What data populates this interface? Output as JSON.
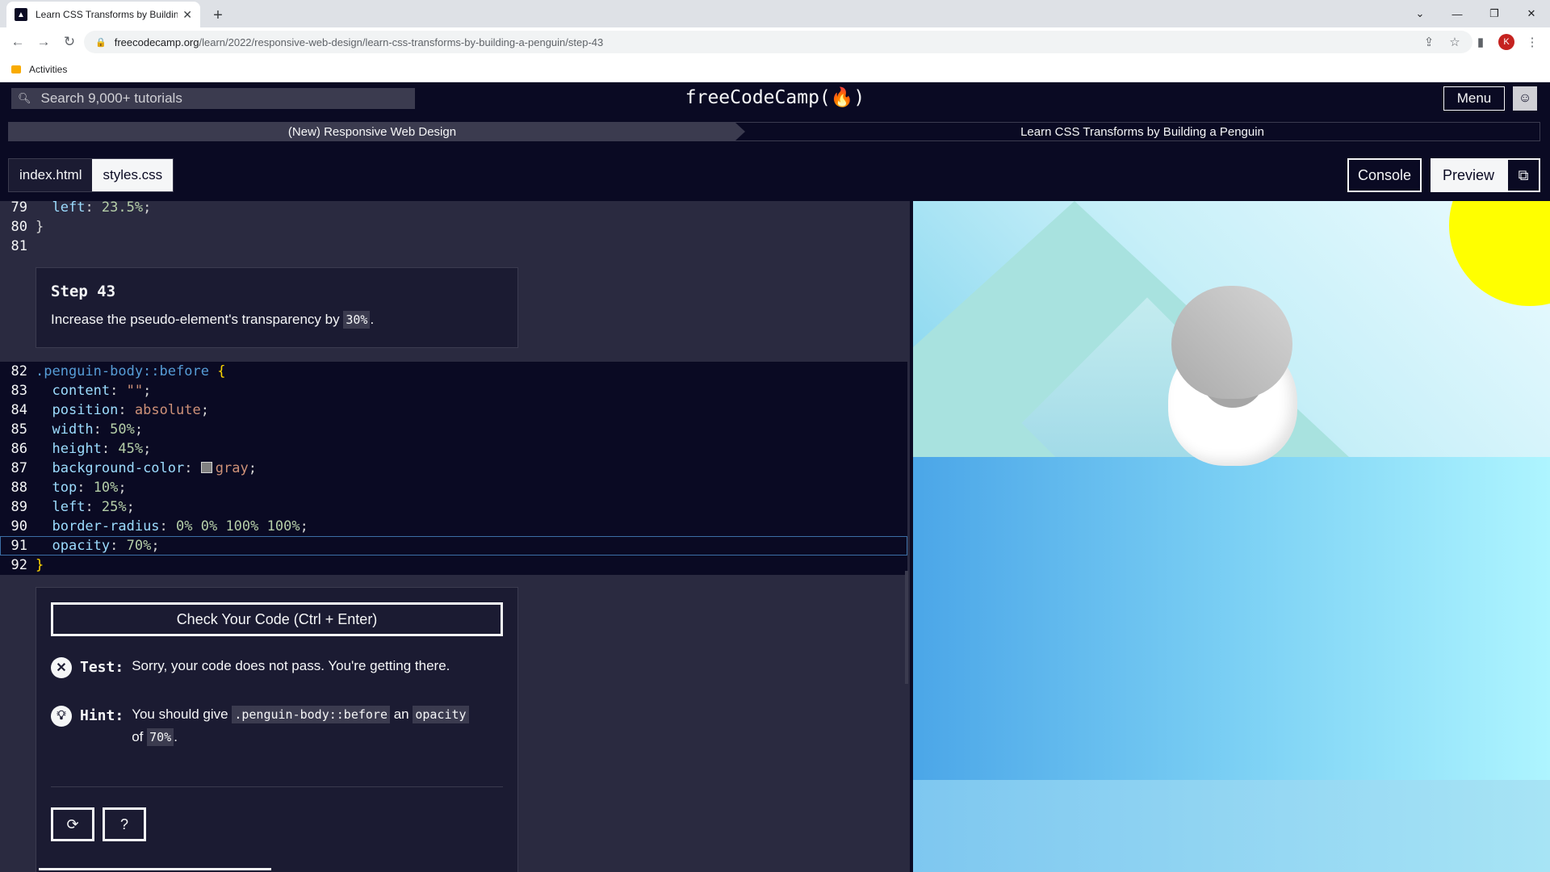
{
  "browser": {
    "tab_title": "Learn CSS Transforms by Building a Penguin",
    "new_tab_label": "+",
    "window_controls": [
      "⌄",
      "—",
      "❐",
      "✕"
    ],
    "url_host": "freecodecamp.org",
    "url_path": "/learn/2022/responsive-web-design/learn-css-transforms-by-building-a-penguin/step-43",
    "profile_initial": "K",
    "bookmark_folder": "Activities"
  },
  "fcc": {
    "search_placeholder": "Search 9,000+ tutorials",
    "logo": "freeCodeCamp(🔥)",
    "menu_label": "Menu",
    "breadcrumb_left": "(New) Responsive Web Design",
    "breadcrumb_right": "Learn CSS Transforms by Building a Penguin"
  },
  "editor_tabs": {
    "tab1": "index.html",
    "tab2": "styles.css"
  },
  "panel_buttons": {
    "console": "Console",
    "preview": "Preview"
  },
  "code_top": {
    "l79_num": "79",
    "l79_prop": "left",
    "l79_val": "23.5%",
    "l80_num": "80",
    "l80_brace": "}",
    "l81_num": "81"
  },
  "step": {
    "title": "Step 43",
    "text_before": "Increase the pseudo-element's transparency by ",
    "code": "30%",
    "text_after": "."
  },
  "code_bottom": {
    "l82_num": "82",
    "l82_sel": ".penguin-body::before",
    "l82_brace": "{",
    "l83_num": "83",
    "l83_prop": "content",
    "l83_val": "\"\"",
    "l84_num": "84",
    "l84_prop": "position",
    "l84_val": "absolute",
    "l85_num": "85",
    "l85_prop": "width",
    "l85_val": "50%",
    "l86_num": "86",
    "l86_prop": "height",
    "l86_val": "45%",
    "l87_num": "87",
    "l87_prop": "background-color",
    "l87_val": "gray",
    "l88_num": "88",
    "l88_prop": "top",
    "l88_val": "10%",
    "l89_num": "89",
    "l89_prop": "left",
    "l89_val": "25%",
    "l90_num": "90",
    "l90_prop": "border-radius",
    "l90_val": "0% 0% 100% 100%",
    "l91_num": "91",
    "l91_prop": "opacity",
    "l91_val": "70%",
    "l92_num": "92",
    "l92_brace": "}"
  },
  "tests": {
    "check_button": "Check Your Code (Ctrl + Enter)",
    "test_label": "Test:",
    "test_text": "Sorry, your code does not pass. You're getting there.",
    "hint_label": "Hint:",
    "hint_text1": "You should give ",
    "hint_code1": ".penguin-body::before",
    "hint_text2": " an ",
    "hint_code2": "opacity",
    "hint_text3": "of ",
    "hint_code3": "70%",
    "hint_text4": "."
  },
  "colors": {
    "fcc_dark": "#0a0a23",
    "editor_bg": "#2a2a40",
    "card_bg": "#1b1b32",
    "sun": "#ffff00"
  }
}
